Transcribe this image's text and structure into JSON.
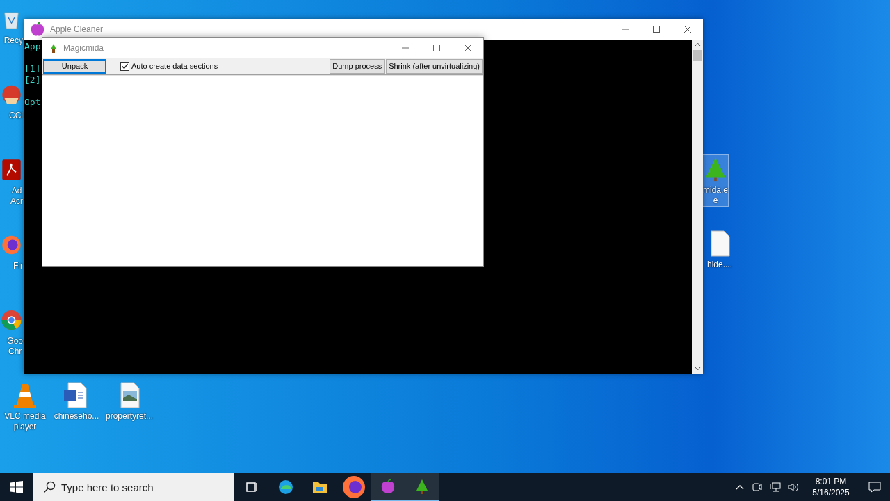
{
  "desktop_icons": [
    {
      "kind": "recycle-bin",
      "label": "Recy"
    },
    {
      "kind": "ccleaner",
      "label": "CCl"
    },
    {
      "kind": "acrobat",
      "label": "Ad\nAcr"
    },
    {
      "kind": "firefox",
      "label": "Fir"
    },
    {
      "kind": "chrome",
      "label": "Goo\nChr"
    },
    {
      "kind": "vlc",
      "label": "VLC media\nplayer"
    },
    {
      "kind": "word-doc",
      "label": "chineseho..."
    },
    {
      "kind": "image-file",
      "label": "propertyret..."
    },
    {
      "kind": "tree",
      "label": "mida.e\ne",
      "selected": true
    },
    {
      "kind": "file",
      "label": "hide...."
    }
  ],
  "console_window": {
    "title": "Apple Cleaner",
    "lines": [
      "App",
      "[1]",
      "[2]",
      "Opt"
    ]
  },
  "magicmida_window": {
    "title": "Magicmida",
    "buttons": [
      {
        "label": "Unpack",
        "focused": true
      }
    ],
    "checkbox": {
      "label": "Auto create data sections",
      "checked": true
    },
    "right_buttons": [
      {
        "label": "Dump process"
      },
      {
        "label": "Shrink (after unvirtualizing)"
      }
    ]
  },
  "taskbar": {
    "search": {
      "placeholder": "Type here to search"
    },
    "apps": [
      {
        "kind": "task-view",
        "running": false
      },
      {
        "kind": "edge",
        "running": false
      },
      {
        "kind": "explorer",
        "running": false
      },
      {
        "kind": "firefox",
        "running": false
      },
      {
        "kind": "apple",
        "running": true
      },
      {
        "kind": "tree",
        "running": true
      }
    ],
    "time": "8:01 PM",
    "date": "5/16/2025"
  }
}
